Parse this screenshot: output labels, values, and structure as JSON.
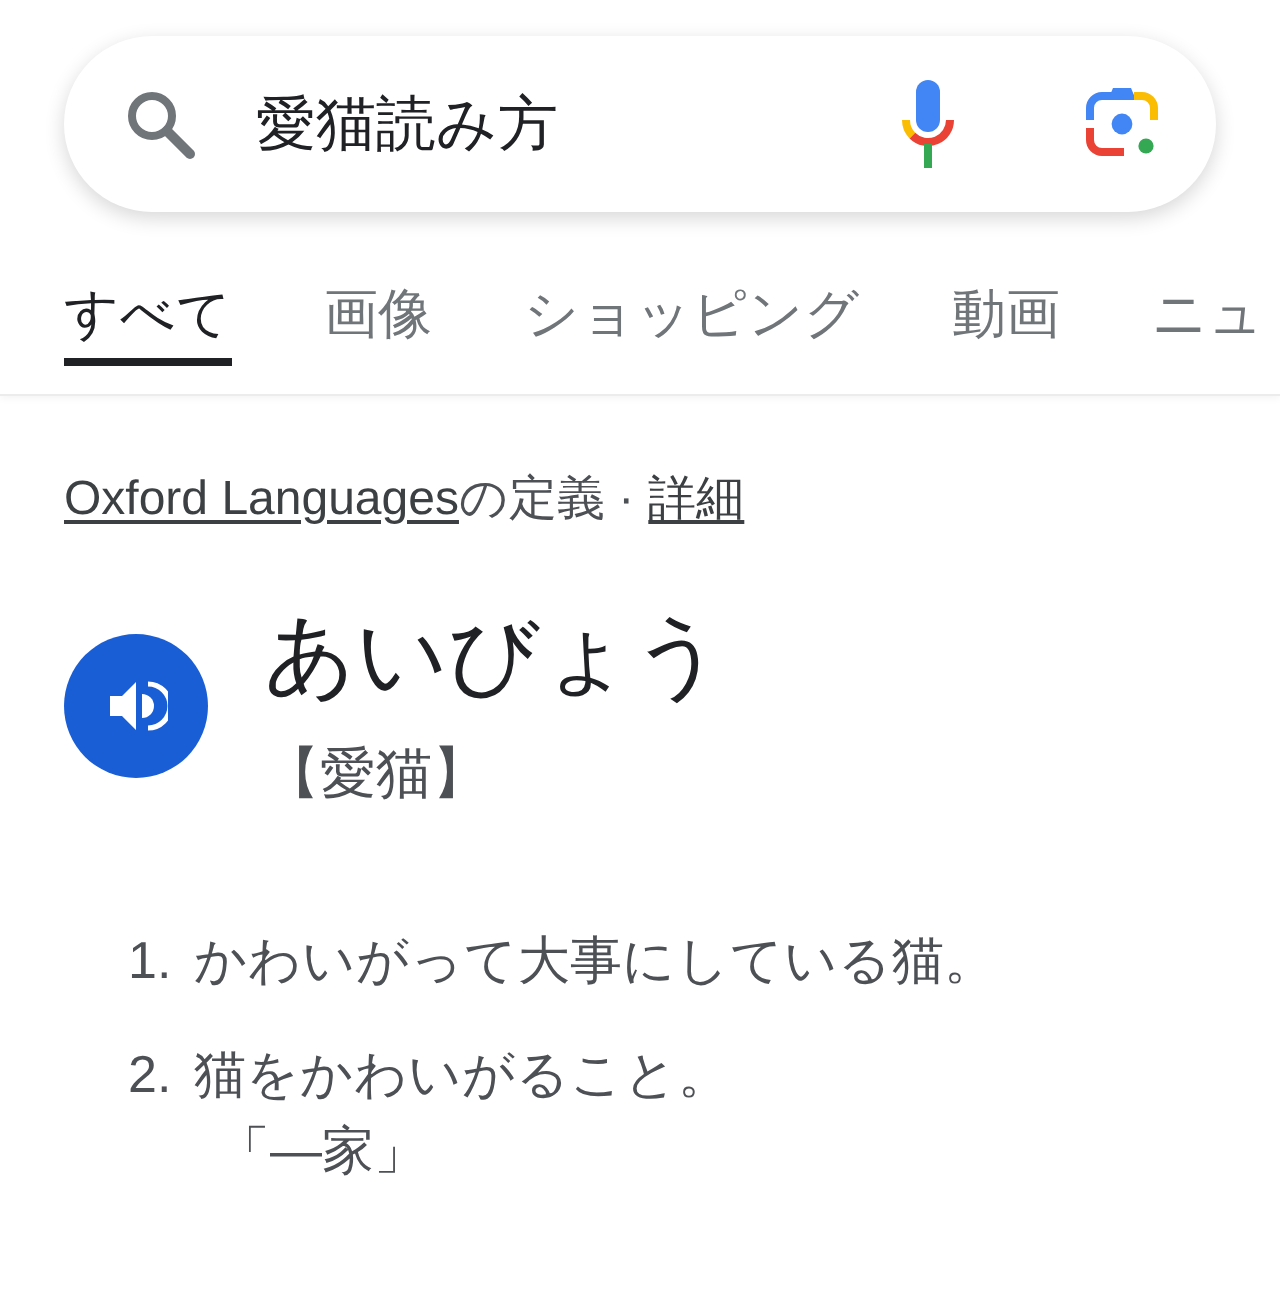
{
  "search": {
    "value": "愛猫読み方"
  },
  "tabs": [
    {
      "label": "すべて",
      "selected": true
    },
    {
      "label": "画像",
      "selected": false
    },
    {
      "label": "ショッピング",
      "selected": false
    },
    {
      "label": "動画",
      "selected": false
    },
    {
      "label": "ニュ",
      "selected": false
    }
  ],
  "definition": {
    "source_link": "Oxford Languages",
    "source_label": "の定義 ·",
    "details_link": "詳細",
    "headword": "あいびょう",
    "kanji": "【愛猫】",
    "senses": [
      {
        "number": "1.",
        "text": "かわいがって大事にしている猫。"
      },
      {
        "number": "2.",
        "text": "猫をかわいがること。",
        "example": "「―家」"
      }
    ]
  }
}
